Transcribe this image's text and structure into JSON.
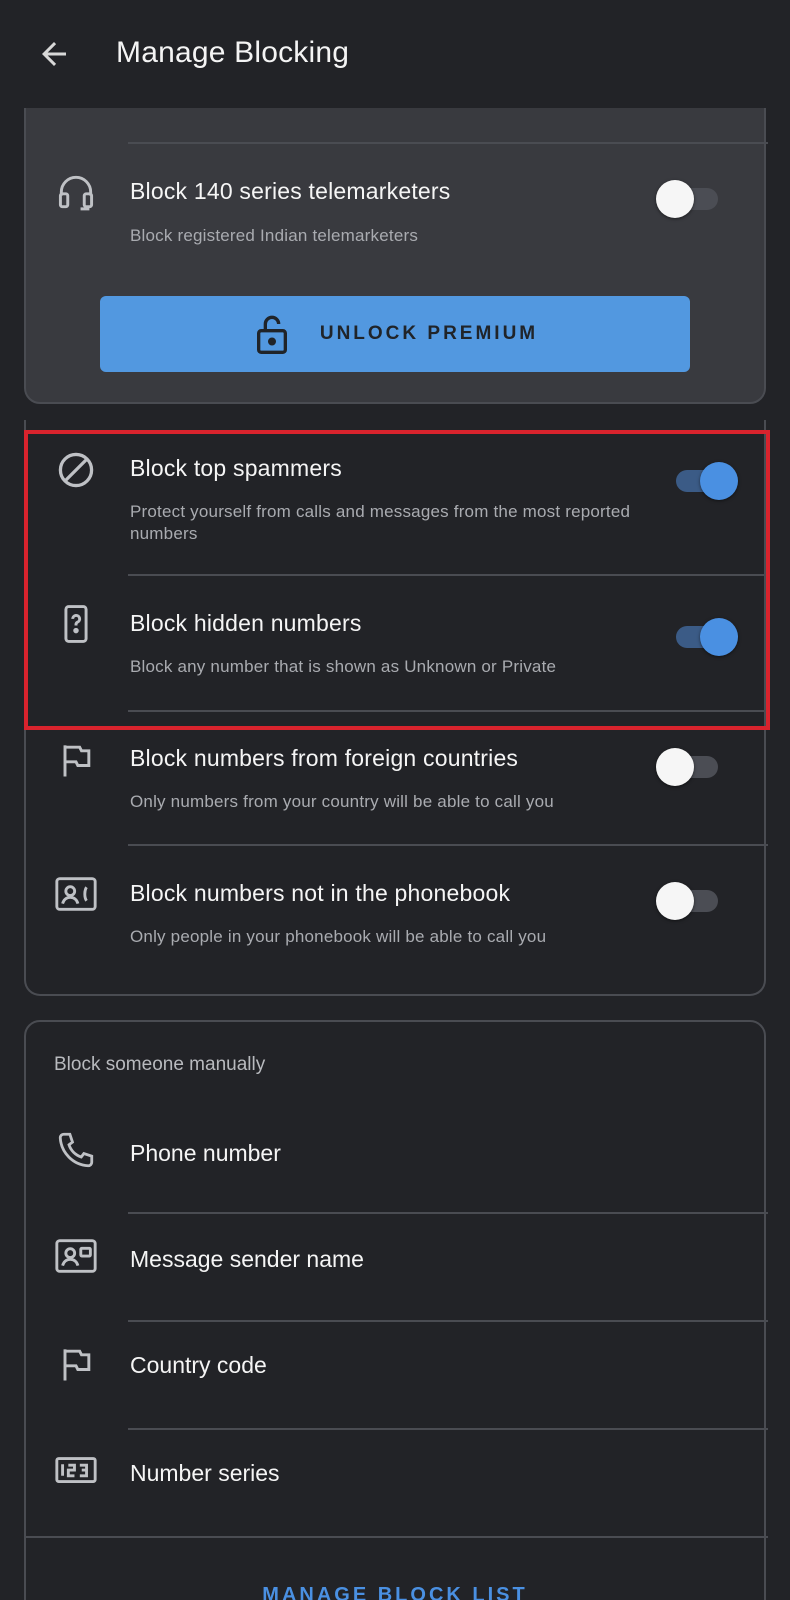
{
  "app_bar": {
    "title": "Manage Blocking"
  },
  "premium": {
    "item": {
      "title": "Block 140 series telemarketers",
      "subtitle": "Block registered Indian telemarketers",
      "enabled": false
    },
    "unlock_label": "UNLOCK PREMIUM"
  },
  "settings": [
    {
      "title": "Block top spammers",
      "subtitle": "Protect yourself from calls and messages from the most reported numbers",
      "enabled": true
    },
    {
      "title": "Block hidden numbers",
      "subtitle": "Block any number that is shown as Unknown or Private",
      "enabled": true
    },
    {
      "title": "Block numbers from foreign countries",
      "subtitle": "Only numbers from your country will be able to call you",
      "enabled": false
    },
    {
      "title": "Block numbers not in the phonebook",
      "subtitle": "Only people in your phonebook will be able to call you",
      "enabled": false
    }
  ],
  "manual": {
    "section_label": "Block someone manually",
    "items": [
      {
        "label": "Phone number",
        "icon": "phone-icon"
      },
      {
        "label": "Message sender name",
        "icon": "contact-card-icon"
      },
      {
        "label": "Country code",
        "icon": "flag-icon"
      },
      {
        "label": "Number series",
        "icon": "number-series-icon"
      }
    ],
    "manage_label": "MANAGE BLOCK LIST"
  },
  "colors": {
    "background": "#222327",
    "card_premium": "#393a3f",
    "accent": "#4a90e2",
    "highlight": "#d9232d",
    "button": "#5298e0"
  }
}
